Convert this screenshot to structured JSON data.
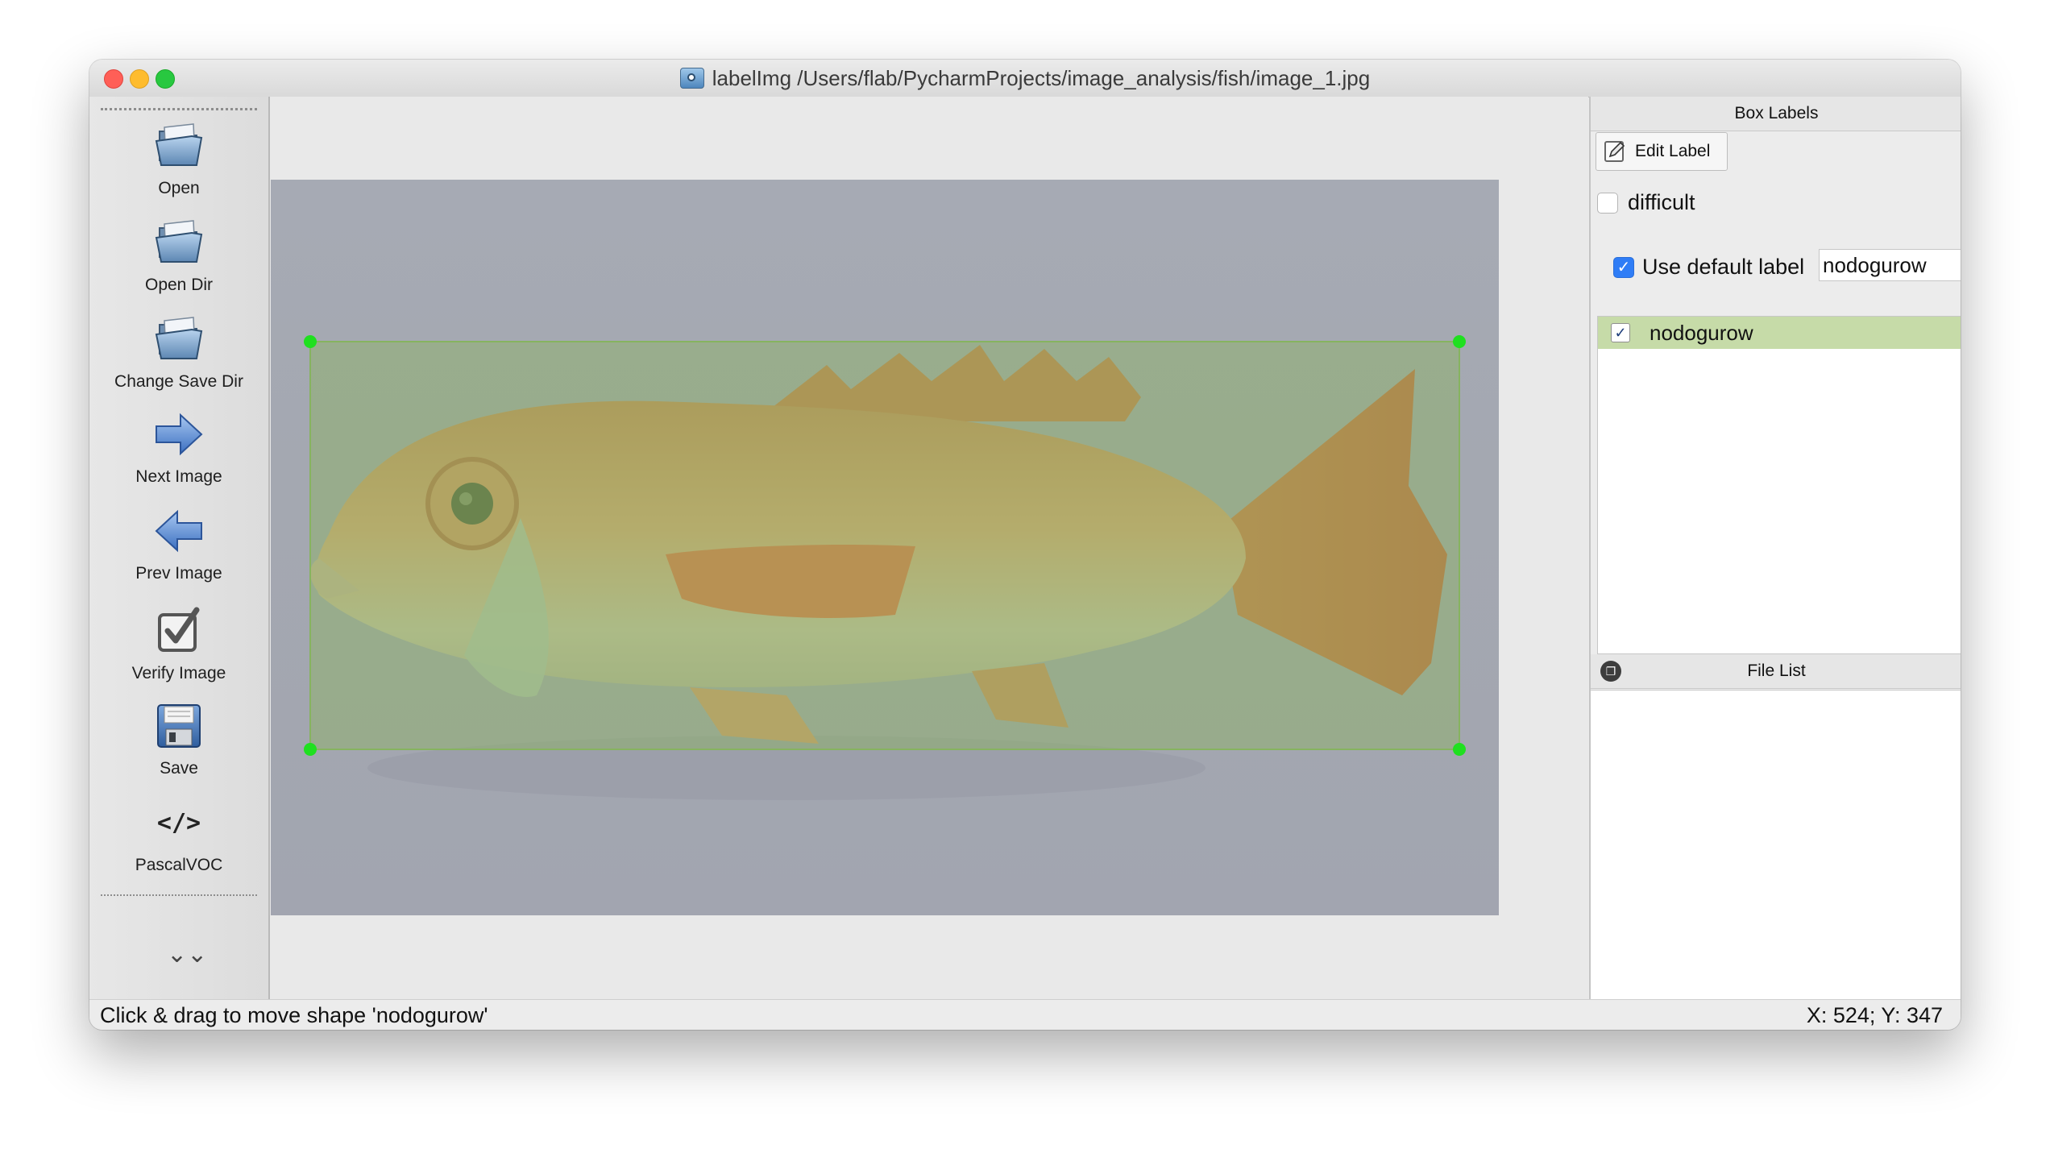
{
  "window": {
    "title": "labelImg /Users/flab/PycharmProjects/image_analysis/fish/image_1.jpg",
    "app_icon": "labelimg-app-icon"
  },
  "toolbar": {
    "items": [
      {
        "label": "Open",
        "icon": "open-folder-icon"
      },
      {
        "label": "Open Dir",
        "icon": "open-dir-folder-icon"
      },
      {
        "label": "Change Save Dir",
        "icon": "change-save-dir-folder-icon"
      },
      {
        "label": "Next Image",
        "icon": "arrow-right-icon"
      },
      {
        "label": "Prev Image",
        "icon": "arrow-left-icon"
      },
      {
        "label": "Verify Image",
        "icon": "verify-checkbox-icon"
      },
      {
        "label": "Save",
        "icon": "floppy-disk-icon"
      },
      {
        "label": "PascalVOC",
        "icon": "code-tag-icon",
        "glyph": "</>"
      }
    ],
    "more_glyph": "⌄⌄"
  },
  "canvas": {
    "image": "fish photo",
    "selected_shape_label": "nodogurow",
    "box_color": "#86b35f",
    "handle_color": "#1fe01f"
  },
  "box_labels_panel": {
    "title": "Box Labels",
    "edit_label_button": "Edit Label",
    "difficult_label": "difficult",
    "difficult_checked": false,
    "use_default_label_text": "Use default label",
    "use_default_label_checked": true,
    "default_label_value": "nodogurow",
    "labels": [
      {
        "text": "nodogurow",
        "checked": true,
        "check_glyph": "✓"
      }
    ]
  },
  "file_list_panel": {
    "title": "File List",
    "files": []
  },
  "status_bar": {
    "message": "Click & drag to move shape 'nodogurow'",
    "coordinates": "X: 524; Y: 347"
  }
}
